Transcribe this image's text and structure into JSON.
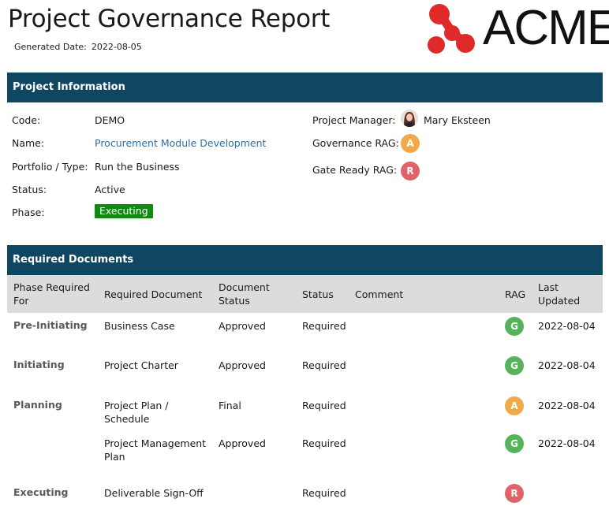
{
  "report": {
    "title": "Project Governance Report",
    "generated_label": "Generated Date:",
    "generated_value": "2022-08-05"
  },
  "logo": {
    "text": "ACME",
    "color": "#e02a2a"
  },
  "colors": {
    "header": "#0f4662",
    "green": "#57b35b",
    "amber": "#f0a94a",
    "red": "#de6468",
    "executing": "#108a10"
  },
  "project_info": {
    "header": "Project Information",
    "code_label": "Code:",
    "code": "DEMO",
    "name_label": "Name:",
    "name": "Procurement Module Development",
    "portfolio_label": "Portfolio / Type:",
    "portfolio": "Run the Business",
    "status_label": "Status:",
    "status": "Active",
    "phase_label": "Phase:",
    "phase": "Executing",
    "pm_label": "Project Manager:",
    "pm": "Mary Eksteen",
    "gov_rag_label": "Governance RAG:",
    "gov_rag": "A",
    "gate_rag_label": "Gate Ready RAG:",
    "gate_rag": "R"
  },
  "documents": {
    "header": "Required Documents",
    "columns": [
      "Phase Required For",
      "Required Document",
      "Document Status",
      "Status",
      "Comment",
      "RAG",
      "Last Updated"
    ],
    "rows": [
      {
        "phase": "Pre-Initiating",
        "document": "Business Case",
        "doc_status": "Approved",
        "status": "Required",
        "comment": "",
        "rag": "G",
        "updated": "2022-08-04"
      },
      {
        "phase": "Initiating",
        "document": "Project Charter",
        "doc_status": "Approved",
        "status": "Required",
        "comment": "",
        "rag": "G",
        "updated": "2022-08-04"
      },
      {
        "phase": "Planning",
        "document": "Project Plan / Schedule",
        "doc_status": "Final",
        "status": "Required",
        "comment": "",
        "rag": "A",
        "updated": "2022-08-04"
      },
      {
        "phase": "",
        "document": "Project Management Plan",
        "doc_status": "Approved",
        "status": "Required",
        "comment": "",
        "rag": "G",
        "updated": "2022-08-04"
      },
      {
        "phase": "Executing",
        "document": "Deliverable Sign-Off",
        "doc_status": "",
        "status": "Required",
        "comment": "",
        "rag": "R",
        "updated": ""
      }
    ]
  }
}
